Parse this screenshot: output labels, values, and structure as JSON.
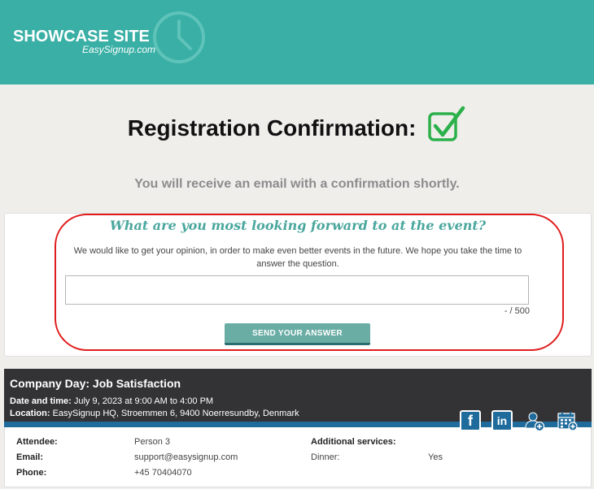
{
  "header": {
    "site_title": "SHOWCASE SITE",
    "site_subtitle": "EasySignup.com",
    "brand_color": "#39afa5"
  },
  "confirmation": {
    "title": "Registration Confirmation:",
    "subtitle": "You will receive an email with a confirmation shortly."
  },
  "survey": {
    "question": "What are you most looking forward to at the event?",
    "description": "We would like to get your opinion, in order to make even better events in the future. We hope you take the time to answer the question.",
    "answer_value": "",
    "counter": "- / 500",
    "send_label": "SEND YOUR ANSWER"
  },
  "event": {
    "title": "Company Day: Job Satisfaction",
    "date_label": "Date and time:",
    "date_value": "July 9, 2023 at 9:00 AM to 4:00 PM",
    "location_label": "Location:",
    "location_value": "EasySignup HQ, Stroemmen 6, 9400 Noerresundby, Denmark",
    "icons": [
      "facebook-icon",
      "linkedin-icon",
      "add-person-icon",
      "add-calendar-icon"
    ]
  },
  "attendee": {
    "attendee_label": "Attendee:",
    "attendee_value": "Person 3",
    "email_label": "Email:",
    "email_value": "support@easysignup.com",
    "phone_label": "Phone:",
    "phone_value": "+45 70404070",
    "services_label": "Additional services:",
    "dinner_label": "Dinner:",
    "dinner_value": "Yes"
  }
}
